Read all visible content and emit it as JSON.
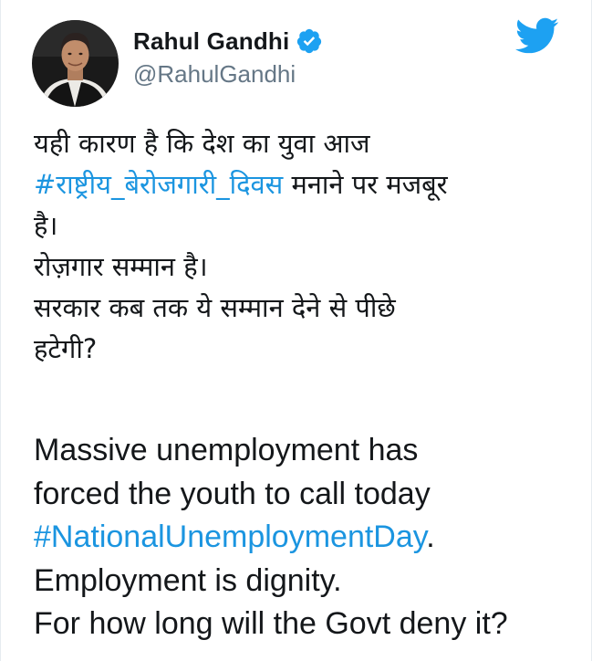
{
  "author": {
    "name": "Rahul Gandhi",
    "handle": "@RahulGandhi",
    "verified_icon": "verified-badge-icon",
    "avatar_icon": "profile-photo"
  },
  "brand": {
    "logo_icon": "twitter-bird-icon",
    "accent_color": "#1da1f2",
    "link_color": "#1b95e0"
  },
  "tweet": {
    "hi": {
      "line1": "यही कारण है कि देश का युवा आज",
      "hashtag": "#राष्ट्रीय_बेरोजगारी_दिवस",
      "line2_rest": " मनाने पर मजबूर",
      "line3": "है।",
      "line4": "रोज़गार सम्मान है।",
      "line5": "सरकार कब तक ये सम्मान देने से पीछे",
      "line6": "हटेगी?"
    },
    "en": {
      "line1": "Massive unemployment has",
      "line2": "forced the youth to call today",
      "hashtag": "#NationalUnemploymentDay",
      "line3_rest": ".",
      "line4": "Employment is dignity.",
      "line5": "For how long will the Govt deny it?"
    }
  }
}
